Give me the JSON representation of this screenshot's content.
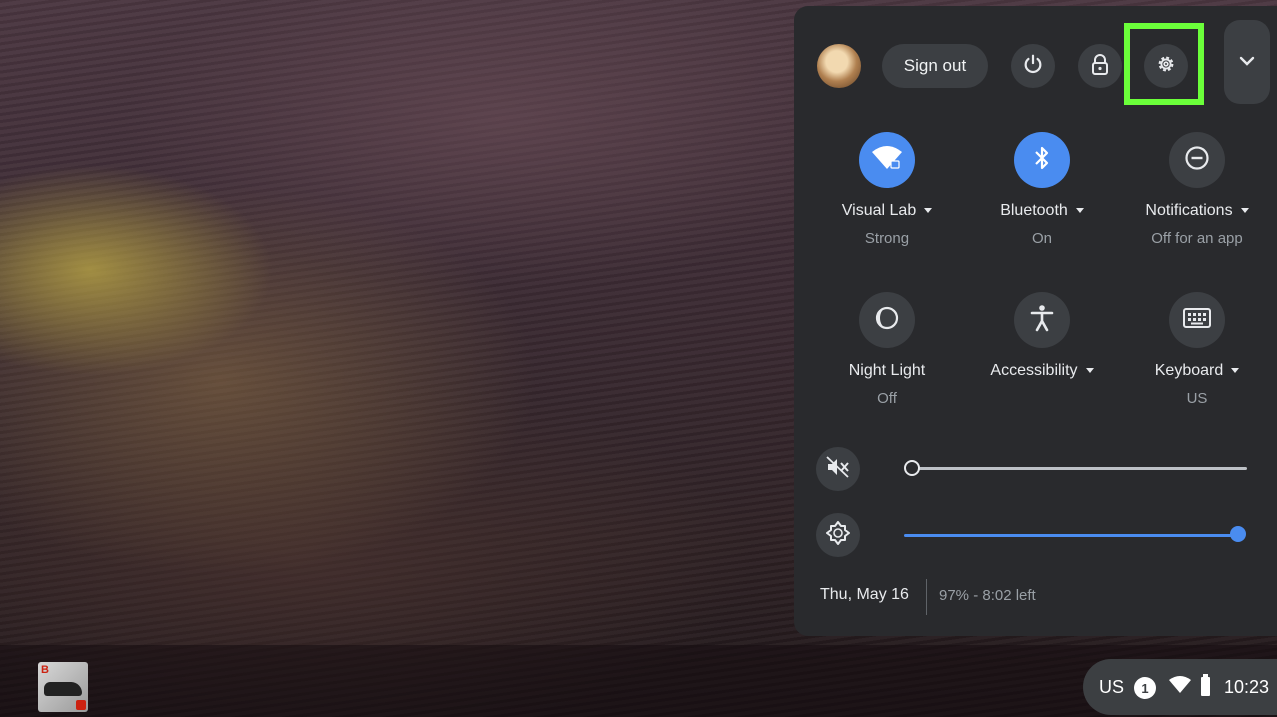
{
  "shelf": {
    "app_badge": "B"
  },
  "status_tray": {
    "ime": "US",
    "notification_count": "1",
    "time": "10:23"
  },
  "quick_settings": {
    "sign_out_label": "Sign out",
    "tiles": [
      {
        "label": "Visual Lab",
        "sub": "Strong",
        "icon": "wifi-icon",
        "active": true
      },
      {
        "label": "Bluetooth",
        "sub": "On",
        "icon": "bluetooth-icon",
        "active": true
      },
      {
        "label": "Notifications",
        "sub": "Off for an app",
        "icon": "do-not-disturb-icon",
        "active": false
      },
      {
        "label": "Night Light",
        "sub": "Off",
        "icon": "night-light-icon",
        "active": false
      },
      {
        "label": "Accessibility",
        "sub": "",
        "icon": "accessibility-icon",
        "active": false
      },
      {
        "label": "Keyboard",
        "sub": "US",
        "icon": "keyboard-icon",
        "active": false
      }
    ],
    "volume_level": 0,
    "brightness_level": 1.0,
    "date": "Thu, May 16",
    "battery": "97% - 8:02 left"
  },
  "colors": {
    "accent": "#4a8cf0",
    "highlight": "#6bff3a",
    "panel": "#292a2d"
  }
}
